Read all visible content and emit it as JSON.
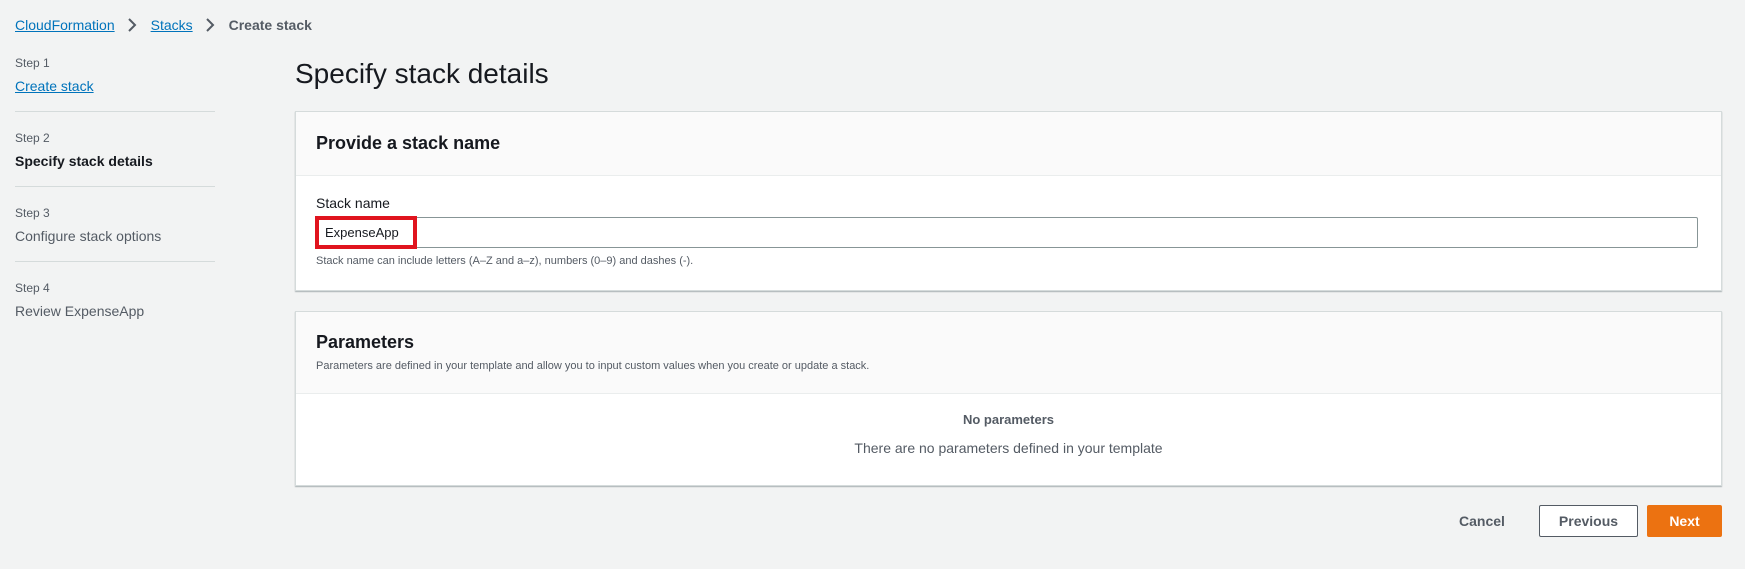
{
  "breadcrumb": {
    "items": [
      "CloudFormation",
      "Stacks"
    ],
    "current": "Create stack"
  },
  "steps": [
    {
      "num": "Step 1",
      "title": "Create stack"
    },
    {
      "num": "Step 2",
      "title": "Specify stack details"
    },
    {
      "num": "Step 3",
      "title": "Configure stack options"
    },
    {
      "num": "Step 4",
      "title": "Review ExpenseApp"
    }
  ],
  "page": {
    "title": "Specify stack details"
  },
  "stack_name_panel": {
    "title": "Provide a stack name",
    "label": "Stack name",
    "value": "ExpenseApp",
    "hint": "Stack name can include letters (A–Z and a–z), numbers (0–9) and dashes (-)."
  },
  "parameters_panel": {
    "title": "Parameters",
    "description": "Parameters are defined in your template and allow you to input custom values when you create or update a stack.",
    "empty_title": "No parameters",
    "empty_desc": "There are no parameters defined in your template"
  },
  "actions": {
    "cancel": "Cancel",
    "previous": "Previous",
    "next": "Next"
  },
  "colors": {
    "link": "#0073bb",
    "primary": "#ec7211",
    "background": "#f2f3f3",
    "highlight": "#e0141e"
  },
  "icons": {
    "breadcrumb_separator": "chevron-right-icon"
  }
}
